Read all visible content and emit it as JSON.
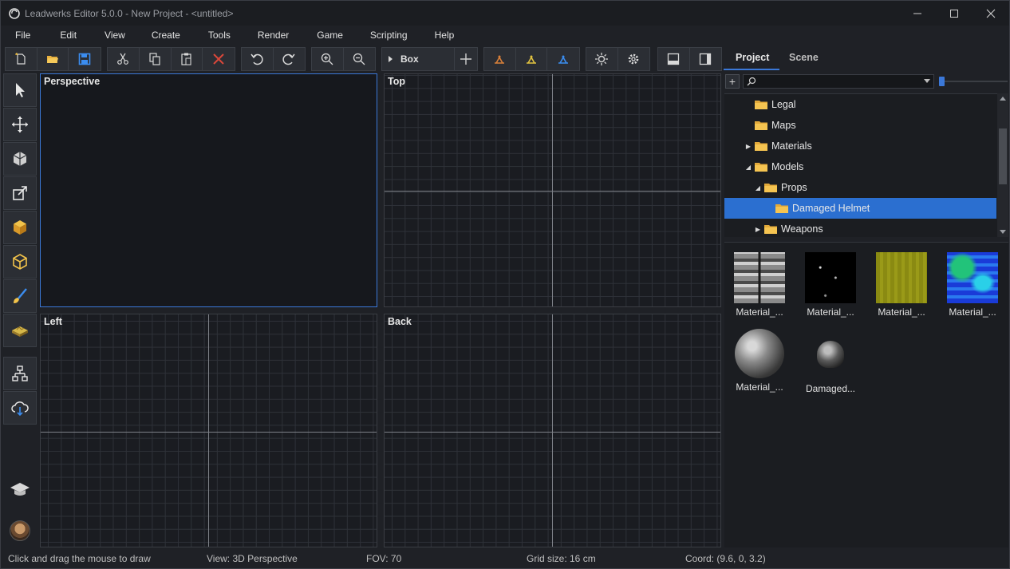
{
  "window": {
    "title": "Leadwerks Editor 5.0.0 - New Project - <untitled>",
    "controls": [
      "minimize-icon",
      "maximize-icon",
      "close-icon"
    ]
  },
  "menu": [
    "File",
    "Edit",
    "View",
    "Create",
    "Tools",
    "Render",
    "Game",
    "Scripting",
    "Help"
  ],
  "toolbar": {
    "brush_selector": "Box",
    "icons": [
      "new-file-icon",
      "open-folder-icon",
      "save-icon",
      "cut-icon",
      "copy-icon",
      "paste-icon",
      "delete-icon",
      "undo-icon",
      "redo-icon",
      "zoom-in-icon",
      "zoom-out-icon",
      "add-icon",
      "move-tool-icon",
      "rotate-tool-icon",
      "scale-tool-icon",
      "light-icon",
      "settings-icon",
      "bottom-panel-icon",
      "side-panel-icon"
    ],
    "accent": "#3b78d8",
    "delete_color": "#d9473a"
  },
  "left_tools": [
    "select-arrow-icon",
    "move-icon",
    "create-object-icon",
    "edit-face-icon",
    "box-brush-icon",
    "wireframe-box-icon",
    "paint-brush-icon",
    "terrain-icon",
    "hierarchy-icon",
    "cloud-download-icon",
    "tutorials-icon",
    "user-avatar"
  ],
  "viewports": {
    "perspective": "Perspective",
    "top": "Top",
    "left": "Left",
    "back": "Back"
  },
  "panel": {
    "tabs": [
      "Project",
      "Scene"
    ],
    "active_tab": "Project",
    "search_placeholder": "",
    "tree": [
      {
        "label": "Legal",
        "expander": "none",
        "indent": 0,
        "selected": false
      },
      {
        "label": "Maps",
        "expander": "none",
        "indent": 0,
        "selected": false
      },
      {
        "label": "Materials",
        "expander": "collapsed",
        "indent": 0,
        "selected": false
      },
      {
        "label": "Models",
        "expander": "expanded",
        "indent": 0,
        "selected": false
      },
      {
        "label": "Props",
        "expander": "expanded",
        "indent": 1,
        "selected": false
      },
      {
        "label": "Damaged Helmet",
        "expander": "none",
        "indent": 2,
        "selected": true
      },
      {
        "label": "Weapons",
        "expander": "collapsed",
        "indent": 1,
        "selected": false
      }
    ],
    "assets": [
      {
        "label": "Material_...",
        "kind": "albedo-texture"
      },
      {
        "label": "Material_...",
        "kind": "emissive-texture"
      },
      {
        "label": "Material_...",
        "kind": "metal-roughness-texture"
      },
      {
        "label": "Material_...",
        "kind": "normal-texture"
      },
      {
        "label": "Material_...",
        "kind": "material-sphere"
      },
      {
        "label": "Damaged...",
        "kind": "helmet-model"
      }
    ]
  },
  "status": {
    "hint": "Click and drag the mouse to draw",
    "view": "View: 3D Perspective",
    "fov": "FOV: 70",
    "grid": "Grid size: 16 cm",
    "coord": "Coord: (9.6, 0, 3.2)"
  }
}
